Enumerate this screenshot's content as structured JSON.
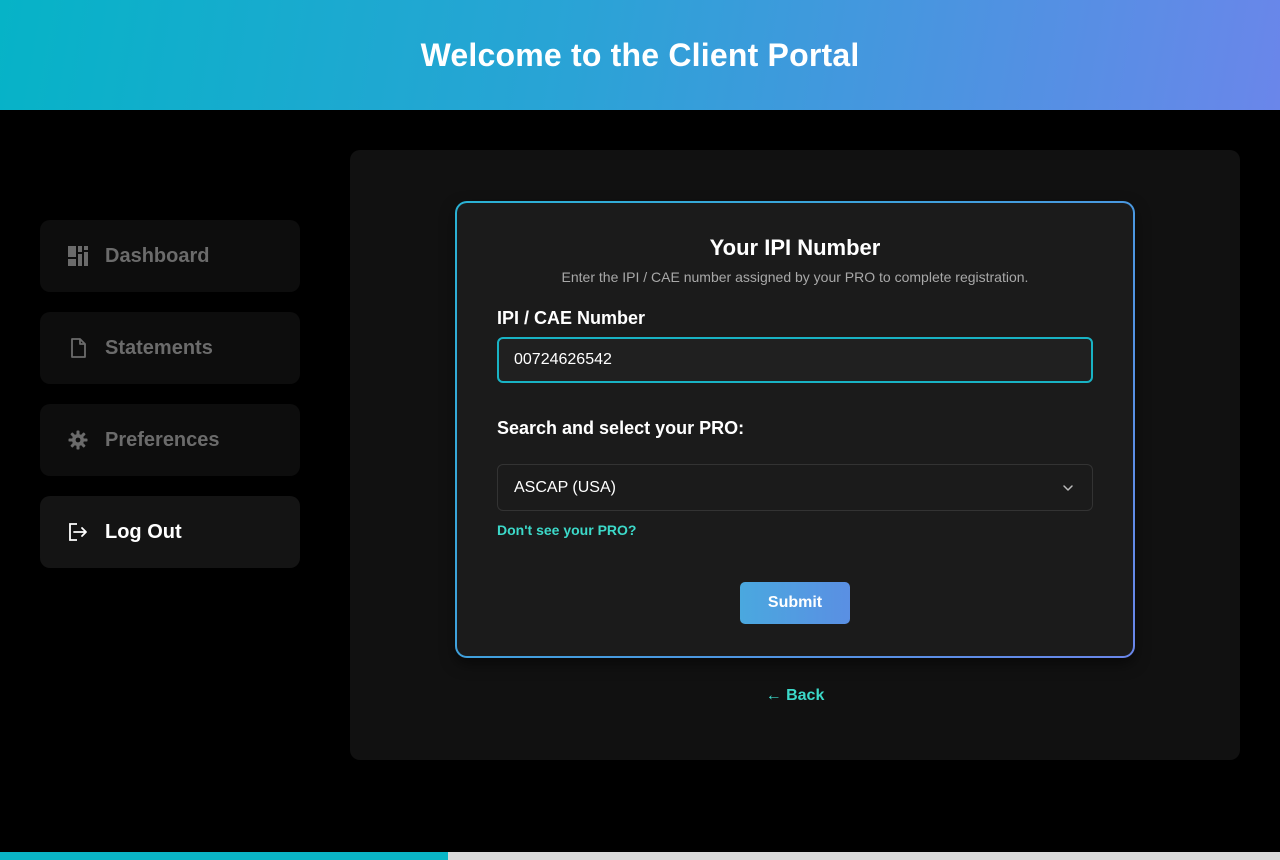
{
  "header": {
    "title": "Welcome to the Client Portal"
  },
  "sidebar": {
    "items": [
      {
        "label": "Dashboard",
        "icon": "dashboard-icon"
      },
      {
        "label": "Statements",
        "icon": "document-icon"
      },
      {
        "label": "Preferences",
        "icon": "gear-icon"
      },
      {
        "label": "Log Out",
        "icon": "logout-icon"
      }
    ]
  },
  "form": {
    "title": "Your IPI Number",
    "subtitle": "Enter the IPI / CAE number assigned by your PRO to complete registration.",
    "ipi_label": "IPI / CAE Number",
    "ipi_value": "00724626542",
    "pro_label": "Search and select your PRO:",
    "pro_selected": "ASCAP (USA)",
    "pro_missing_link": "Don't see your PRO?",
    "submit_label": "Submit",
    "back_label": "← Back"
  },
  "progress": {
    "fraction": 0.35
  },
  "colors": {
    "accent_teal": "#3cd9c9",
    "header_gradient_start": "#06b3c7",
    "header_gradient_end": "#6a86ea",
    "progress_fill": "#0ab5c6"
  }
}
